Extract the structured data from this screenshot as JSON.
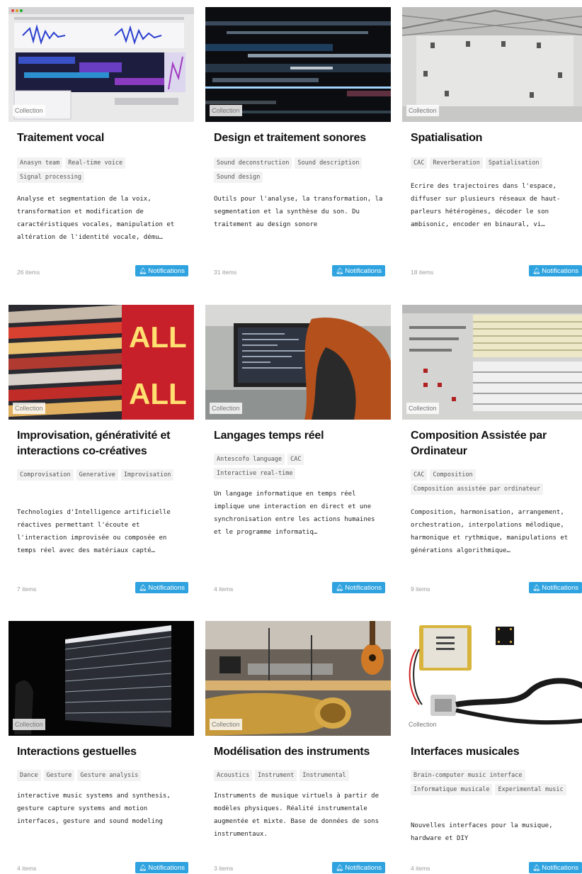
{
  "cards": [
    {
      "badge": "Collection",
      "title": "Traitement vocal",
      "tags": [
        "Anasyn team",
        "Real-time voice",
        "Signal processing"
      ],
      "description": "Analyse et segmentation de la voix, transformation et modification de caractéristiques vocales, manipulation et altération de l'identité vocale, dému…",
      "count": "26 items",
      "button": "Notifications",
      "image": "screenshot of audio editing software"
    },
    {
      "badge": "Collection",
      "title": "Design et traitement sonores",
      "tags": [
        "Sound deconstruction",
        "Sound description",
        "Sound design"
      ],
      "description": "Outils pour l'analyse, la transformation, la segmentation et la synthèse du son. Du traitement au design sonore",
      "count": "31 items",
      "button": "Notifications",
      "image": "glitch texture"
    },
    {
      "badge": "Collection",
      "title": "Spatialisation",
      "tags": [
        "CAC",
        "Reverberation",
        "Spatialisation"
      ],
      "description": "Ecrire des trajectoires dans l'espace, diffuser sur plusieurs réseaux de haut-parleurs hétérogènes, décoder le son ambisonic, encoder en binaural, vi…",
      "count": "18 items",
      "button": "Notifications",
      "image": "concert hall with speakers"
    },
    {
      "badge": "Collection",
      "title": "Improvisation, générativité et interactions co-créatives",
      "tags": [
        "Comprovisation",
        "Generative",
        "Improvisation"
      ],
      "description": "Technologies d'Intelligence artificielle réactives permettant l'écoute et l'interaction improvisée ou composée en temps réel avec des matériaux capté…",
      "count": "7 items",
      "button": "Notifications",
      "image": "illuminated building sign"
    },
    {
      "badge": "Collection",
      "title": "Langages temps réel",
      "tags": [
        "Antescofo language",
        "CAC",
        "Interactive real-time"
      ],
      "description": "Un langage informatique en temps réel implique une interaction en direct et une synchronisation entre les actions humaines et le programme informatiq…",
      "count": "4 items",
      "button": "Notifications",
      "image": "person coding at a monitor"
    },
    {
      "badge": "Collection",
      "title": "Composition Assistée par Ordinateur",
      "tags": [
        "CAC",
        "Composition",
        "Composition assistée par ordinateur"
      ],
      "description": "Composition, harmonisation, arrangement, orchestration, interpolations mélodique, harmonique et rythmique, manipulations et générations algorithmique…",
      "count": "9 items",
      "button": "Notifications",
      "image": "composition software screenshot"
    },
    {
      "badge": "Collection",
      "title": "Interactions gestuelles",
      "tags": [
        "Dance",
        "Gesture",
        "Gesture analysis"
      ],
      "description": "interactive music systems and synthesis, gesture capture systems and motion interfaces, gesture and sound modeling",
      "count": "4 items",
      "button": "Notifications",
      "image": "dark projection installation"
    },
    {
      "badge": "Collection",
      "title": "Modélisation des instruments",
      "tags": [
        "Acoustics",
        "Instrument",
        "Instrumental"
      ],
      "description": "Instruments de musique virtuels à partir de modèles physiques. Réalité instrumentale augmentée et mixte. Base de données de sons instrumentaux.",
      "count": "3 items",
      "button": "Notifications",
      "image": "laboratory with brass instrument and guitar"
    },
    {
      "badge": "Collection",
      "title": "Interfaces musicales",
      "tags": [
        "Brain-computer music interface",
        "Informatique musicale",
        "Experimental music"
      ],
      "description": "Nouvelles interfaces pour la musique, hardware et DIY",
      "count": "4 items",
      "button": "Notifications",
      "image": "battery, circuit board and usb cable"
    }
  ],
  "icons": {
    "button": "bell-icon"
  },
  "colors": {
    "button_bg": "#2fa3df"
  }
}
